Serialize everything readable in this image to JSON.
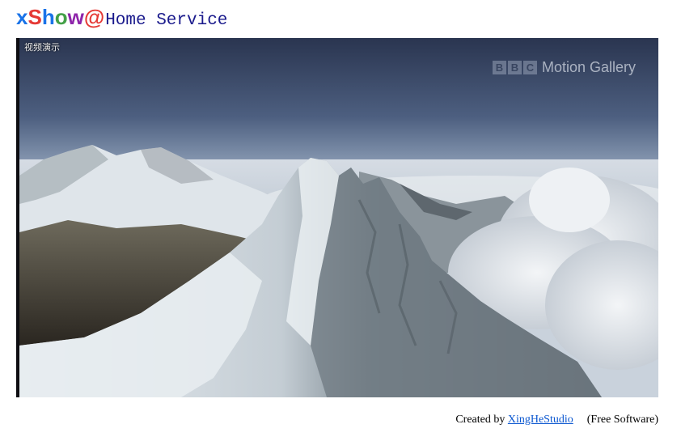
{
  "header": {
    "logo": {
      "x": "x",
      "s": "S",
      "h": "h",
      "o": "o",
      "w": "w",
      "at": "@"
    },
    "title": "Home Service"
  },
  "video": {
    "caption": "视频演示",
    "watermark": {
      "boxes": [
        "B",
        "B",
        "C"
      ],
      "text": "Motion Gallery"
    }
  },
  "footer": {
    "created_by": "Created by",
    "link": "XingHeStudio",
    "license": "(Free Software)"
  }
}
